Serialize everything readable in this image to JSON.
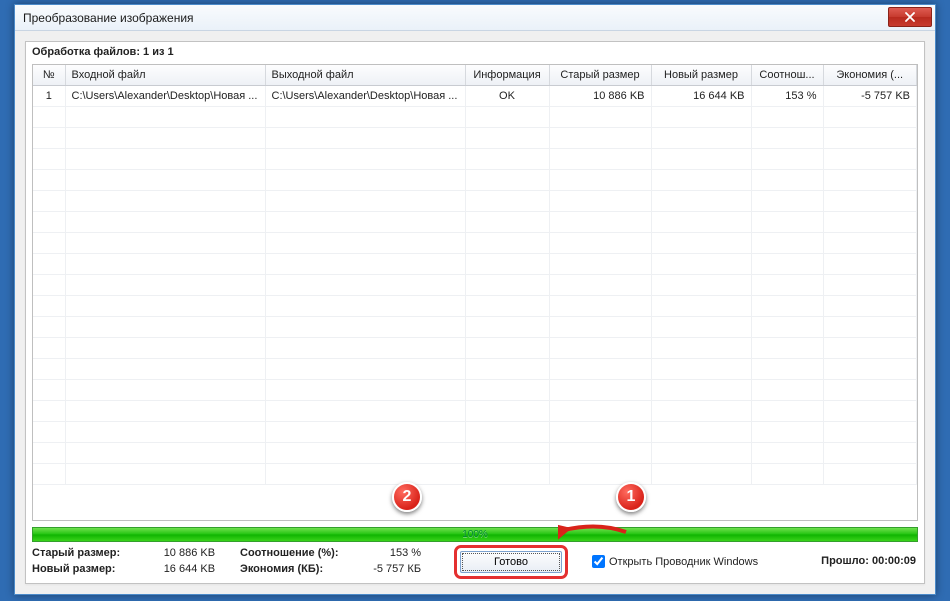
{
  "window": {
    "title": "Преобразование изображения"
  },
  "status": "Обработка файлов: 1 из 1",
  "columns": {
    "n": "№",
    "input": "Входной файл",
    "output": "Выходной файл",
    "info": "Информация",
    "old": "Старый размер",
    "new": "Новый размер",
    "ratio": "Соотнош...",
    "save": "Экономия (..."
  },
  "rows": [
    {
      "n": "1",
      "input": "C:\\Users\\Alexander\\Desktop\\Новая ...",
      "output": "C:\\Users\\Alexander\\Desktop\\Новая ...",
      "info": "OK",
      "old": "10 886 KB",
      "new": "16 644 KB",
      "ratio": "153 %",
      "save": "-5 757 KB"
    }
  ],
  "progress": {
    "text": "100%"
  },
  "summary": {
    "old_label": "Старый размер:",
    "old_value": "10 886 KB",
    "new_label": "Новый размер:",
    "new_value": "16 644 KB",
    "ratio_label": "Соотношение (%):",
    "ratio_value": "153 %",
    "save_label": "Экономия (КБ):",
    "save_value": "-5 757 КБ"
  },
  "done_label": "Готово",
  "open_explorer_label": "Открыть Проводник Windows",
  "elapsed_label": "Прошло: 00:00:09",
  "markers": {
    "one": "1",
    "two": "2"
  }
}
